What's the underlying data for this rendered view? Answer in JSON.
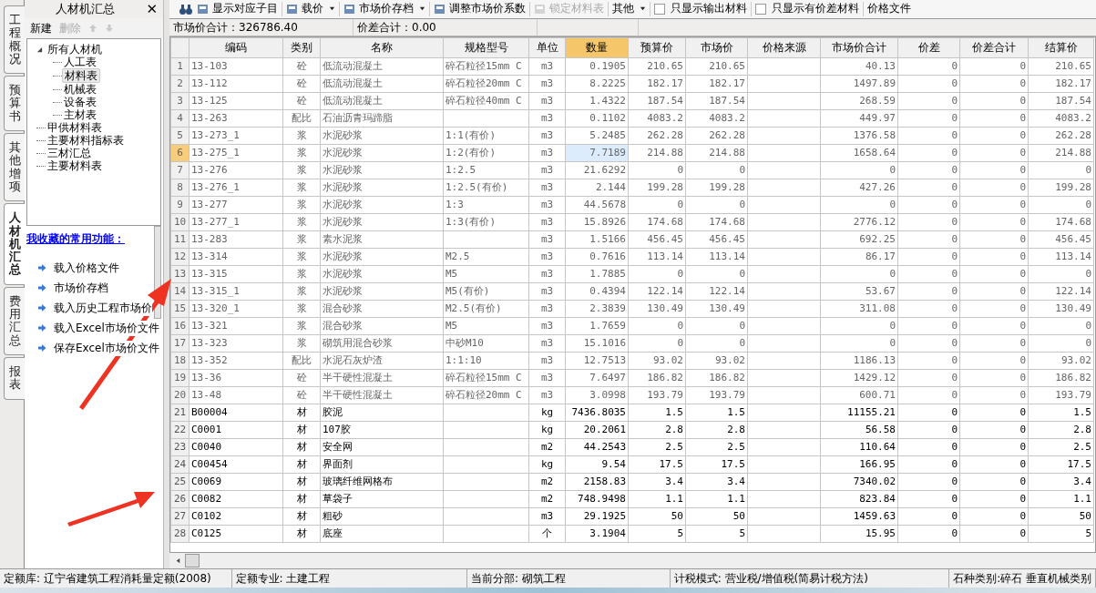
{
  "side_tabs": [
    {
      "label": "工程概况",
      "selected": false
    },
    {
      "label": "预算书",
      "selected": false
    },
    {
      "label": "其他增项",
      "selected": false
    },
    {
      "label": "人材机汇总",
      "selected": true
    },
    {
      "label": "费用汇总",
      "selected": false
    },
    {
      "label": "报表",
      "selected": false
    }
  ],
  "panel": {
    "title": "人材机汇总",
    "close": "✕",
    "actions": [
      {
        "label": "新建",
        "disabled": false
      },
      {
        "label": "删除",
        "disabled": true
      }
    ],
    "tree": [
      {
        "label": "所有人材机",
        "expanded": true,
        "selected": false,
        "children": [
          {
            "label": "人工表",
            "selected": false
          },
          {
            "label": "材料表",
            "selected": true
          },
          {
            "label": "机械表",
            "selected": false
          },
          {
            "label": "设备表",
            "selected": false
          },
          {
            "label": "主材表",
            "selected": false
          }
        ]
      },
      {
        "label": "甲供材料表",
        "selected": false
      },
      {
        "label": "主要材料指标表",
        "selected": false
      },
      {
        "label": "三材汇总",
        "selected": false
      },
      {
        "label": "主要材料表",
        "selected": false
      }
    ],
    "favorites_title": "我收藏的常用功能：",
    "favorites": [
      "载入价格文件",
      "市场价存档",
      "载入历史工程市场价",
      "载入Excel市场价文件",
      "保存Excel市场价文件"
    ]
  },
  "toolbar": [
    {
      "kind": "icon"
    },
    {
      "kind": "button",
      "label": "显示对应子目",
      "disabled": false,
      "dropdown": false
    },
    {
      "kind": "button",
      "label": "载价",
      "disabled": false,
      "dropdown": true
    },
    {
      "kind": "button",
      "label": "市场价存档",
      "disabled": false,
      "dropdown": true
    },
    {
      "kind": "button",
      "label": "调整市场价系数",
      "disabled": false,
      "dropdown": false
    },
    {
      "kind": "button",
      "label": "锁定材料表",
      "disabled": true,
      "dropdown": false
    },
    {
      "kind": "menu",
      "label": "其他",
      "dropdown": true
    },
    {
      "kind": "checkbox",
      "label": "只显示输出材料",
      "checked": false
    },
    {
      "kind": "checkbox",
      "label": "只显示有价差材料",
      "checked": false
    },
    {
      "kind": "text",
      "label": "价格文件"
    }
  ],
  "summary": [
    "市场价合计：326786.40",
    "价差合计：0.00"
  ],
  "table": {
    "columns": [
      {
        "label": "编码",
        "sorted": false
      },
      {
        "label": "类别",
        "sorted": false
      },
      {
        "label": "名称",
        "sorted": false
      },
      {
        "label": "规格型号",
        "sorted": false
      },
      {
        "label": "单位",
        "sorted": false
      },
      {
        "label": "数量",
        "sorted": true
      },
      {
        "label": "预算价",
        "sorted": false
      },
      {
        "label": "市场价",
        "sorted": false
      },
      {
        "label": "价格来源",
        "sorted": false
      },
      {
        "label": "市场价合计",
        "sorted": false
      },
      {
        "label": "价差",
        "sorted": false
      },
      {
        "label": "价差合计",
        "sorted": false
      },
      {
        "label": "结算价",
        "sorted": false
      }
    ],
    "rows": [
      {
        "no": "1",
        "mixture": true,
        "selected": false,
        "code": "13-103",
        "category": "砼",
        "name": "低流动混凝土",
        "spec": "碎石粒径15mm C",
        "unit": "m3",
        "qty": "0.1905",
        "budget": "210.65",
        "market": "210.65",
        "total": "40.13",
        "diff": "0",
        "diff_total": "0",
        "settle": "210.65"
      },
      {
        "no": "2",
        "mixture": true,
        "selected": false,
        "code": "13-112",
        "category": "砼",
        "name": "低流动混凝土",
        "spec": "碎石粒径20mm C",
        "unit": "m3",
        "qty": "8.2225",
        "budget": "182.17",
        "market": "182.17",
        "total": "1497.89",
        "diff": "0",
        "diff_total": "0",
        "settle": "182.17"
      },
      {
        "no": "3",
        "mixture": true,
        "selected": false,
        "code": "13-125",
        "category": "砼",
        "name": "低流动混凝土",
        "spec": "碎石粒径40mm C",
        "unit": "m3",
        "qty": "1.4322",
        "budget": "187.54",
        "market": "187.54",
        "total": "268.59",
        "diff": "0",
        "diff_total": "0",
        "settle": "187.54"
      },
      {
        "no": "4",
        "mixture": true,
        "selected": false,
        "code": "13-263",
        "category": "配比",
        "name": "石油沥青玛蹄脂",
        "unit": "m3",
        "qty": "0.1102",
        "budget": "4083.2",
        "market": "4083.2",
        "total": "449.97",
        "diff": "0",
        "diff_total": "0",
        "settle": "4083.2"
      },
      {
        "no": "5",
        "mixture": true,
        "selected": false,
        "code": "13-273_1",
        "category": "浆",
        "name": "水泥砂浆",
        "spec": "1:1(有价)",
        "unit": "m3",
        "qty": "5.2485",
        "budget": "262.28",
        "market": "262.28",
        "total": "1376.58",
        "diff": "0",
        "diff_total": "0",
        "settle": "262.28"
      },
      {
        "no": "6",
        "mixture": true,
        "selected": true,
        "code": "13-275_1",
        "category": "浆",
        "name": "水泥砂浆",
        "spec": "1:2(有价)",
        "unit": "m3",
        "qty": "7.7189",
        "budget": "214.88",
        "market": "214.88",
        "total": "1658.64",
        "diff": "0",
        "diff_total": "0",
        "settle": "214.88"
      },
      {
        "no": "7",
        "mixture": true,
        "selected": false,
        "code": "13-276",
        "category": "浆",
        "name": "水泥砂浆",
        "spec": "1:2.5",
        "unit": "m3",
        "qty": "21.6292",
        "budget": "0",
        "market": "0",
        "total": "0",
        "diff": "0",
        "diff_total": "0",
        "settle": "0"
      },
      {
        "no": "8",
        "mixture": true,
        "selected": false,
        "code": "13-276_1",
        "category": "浆",
        "name": "水泥砂浆",
        "spec": "1:2.5(有价)",
        "unit": "m3",
        "qty": "2.144",
        "budget": "199.28",
        "market": "199.28",
        "total": "427.26",
        "diff": "0",
        "diff_total": "0",
        "settle": "199.28"
      },
      {
        "no": "9",
        "mixture": true,
        "selected": false,
        "code": "13-277",
        "category": "浆",
        "name": "水泥砂浆",
        "spec": "1:3",
        "unit": "m3",
        "qty": "44.5678",
        "budget": "0",
        "market": "0",
        "total": "0",
        "diff": "0",
        "diff_total": "0",
        "settle": "0"
      },
      {
        "no": "10",
        "mixture": true,
        "selected": false,
        "code": "13-277_1",
        "category": "浆",
        "name": "水泥砂浆",
        "spec": "1:3(有价)",
        "unit": "m3",
        "qty": "15.8926",
        "budget": "174.68",
        "market": "174.68",
        "total": "2776.12",
        "diff": "0",
        "diff_total": "0",
        "settle": "174.68"
      },
      {
        "no": "11",
        "mixture": true,
        "selected": false,
        "code": "13-283",
        "category": "浆",
        "name": "素水泥浆",
        "unit": "m3",
        "qty": "1.5166",
        "budget": "456.45",
        "market": "456.45",
        "total": "692.25",
        "diff": "0",
        "diff_total": "0",
        "settle": "456.45"
      },
      {
        "no": "12",
        "mixture": true,
        "selected": false,
        "code": "13-314",
        "category": "浆",
        "name": "水泥砂浆",
        "spec": "M2.5",
        "unit": "m3",
        "qty": "0.7616",
        "budget": "113.14",
        "market": "113.14",
        "total": "86.17",
        "diff": "0",
        "diff_total": "0",
        "settle": "113.14"
      },
      {
        "no": "13",
        "mixture": true,
        "selected": false,
        "code": "13-315",
        "category": "浆",
        "name": "水泥砂浆",
        "spec": "M5",
        "unit": "m3",
        "qty": "1.7885",
        "budget": "0",
        "market": "0",
        "total": "0",
        "diff": "0",
        "diff_total": "0",
        "settle": "0"
      },
      {
        "no": "14",
        "mixture": true,
        "selected": false,
        "code": "13-315_1",
        "category": "浆",
        "name": "水泥砂浆",
        "spec": "M5(有价)",
        "unit": "m3",
        "qty": "0.4394",
        "budget": "122.14",
        "market": "122.14",
        "total": "53.67",
        "diff": "0",
        "diff_total": "0",
        "settle": "122.14"
      },
      {
        "no": "15",
        "mixture": true,
        "selected": false,
        "code": "13-320_1",
        "category": "浆",
        "name": "混合砂浆",
        "spec": "M2.5(有价)",
        "unit": "m3",
        "qty": "2.3839",
        "budget": "130.49",
        "market": "130.49",
        "total": "311.08",
        "diff": "0",
        "diff_total": "0",
        "settle": "130.49"
      },
      {
        "no": "16",
        "mixture": true,
        "selected": false,
        "code": "13-321",
        "category": "浆",
        "name": "混合砂浆",
        "spec": "M5",
        "unit": "m3",
        "qty": "1.7659",
        "budget": "0",
        "market": "0",
        "total": "0",
        "diff": "0",
        "diff_total": "0",
        "settle": "0"
      },
      {
        "no": "17",
        "mixture": true,
        "selected": false,
        "code": "13-323",
        "category": "浆",
        "name": "砌筑用混合砂浆",
        "spec": "中砂M10",
        "unit": "m3",
        "qty": "15.1016",
        "budget": "0",
        "market": "0",
        "total": "0",
        "diff": "0",
        "diff_total": "0",
        "settle": "0"
      },
      {
        "no": "18",
        "mixture": true,
        "selected": false,
        "code": "13-352",
        "category": "配比",
        "name": "水泥石灰炉渣",
        "spec": "1:1:10",
        "unit": "m3",
        "qty": "12.7513",
        "budget": "93.02",
        "market": "93.02",
        "total": "1186.13",
        "diff": "0",
        "diff_total": "0",
        "settle": "93.02"
      },
      {
        "no": "19",
        "mixture": true,
        "selected": false,
        "code": "13-36",
        "category": "砼",
        "name": "半干硬性混凝土",
        "spec": "碎石粒径15mm C",
        "unit": "m3",
        "qty": "7.6497",
        "budget": "186.82",
        "market": "186.82",
        "total": "1429.12",
        "diff": "0",
        "diff_total": "0",
        "settle": "186.82"
      },
      {
        "no": "20",
        "mixture": true,
        "selected": false,
        "code": "13-48",
        "category": "砼",
        "name": "半干硬性混凝土",
        "spec": "碎石粒径20mm C",
        "unit": "m3",
        "qty": "3.0998",
        "budget": "193.79",
        "market": "193.79",
        "total": "600.71",
        "diff": "0",
        "diff_total": "0",
        "settle": "193.79"
      },
      {
        "no": "21",
        "mixture": false,
        "selected": false,
        "code": "B00004",
        "category": "材",
        "name": "胶泥",
        "unit": "kg",
        "qty": "7436.8035",
        "budget": "1.5",
        "market": "1.5",
        "total": "11155.21",
        "diff": "0",
        "diff_total": "0",
        "settle": "1.5"
      },
      {
        "no": "22",
        "mixture": false,
        "selected": false,
        "code": "C0001",
        "category": "材",
        "name": "107胶",
        "unit": "kg",
        "qty": "20.2061",
        "budget": "2.8",
        "market": "2.8",
        "total": "56.58",
        "diff": "0",
        "diff_total": "0",
        "settle": "2.8"
      },
      {
        "no": "23",
        "mixture": false,
        "selected": false,
        "code": "C0040",
        "category": "材",
        "name": "安全网",
        "unit": "m2",
        "qty": "44.2543",
        "budget": "2.5",
        "market": "2.5",
        "total": "110.64",
        "diff": "0",
        "diff_total": "0",
        "settle": "2.5"
      },
      {
        "no": "24",
        "mixture": false,
        "selected": false,
        "code": "C00454",
        "category": "材",
        "name": "界面剂",
        "unit": "kg",
        "qty": "9.54",
        "budget": "17.5",
        "market": "17.5",
        "total": "166.95",
        "diff": "0",
        "diff_total": "0",
        "settle": "17.5"
      },
      {
        "no": "25",
        "mixture": false,
        "selected": false,
        "code": "C0069",
        "category": "材",
        "name": "玻璃纤维网格布",
        "unit": "m2",
        "qty": "2158.83",
        "budget": "3.4",
        "market": "3.4",
        "total": "7340.02",
        "diff": "0",
        "diff_total": "0",
        "settle": "3.4"
      },
      {
        "no": "26",
        "mixture": false,
        "selected": false,
        "code": "C0082",
        "category": "材",
        "name": "草袋子",
        "unit": "m2",
        "qty": "748.9498",
        "budget": "1.1",
        "market": "1.1",
        "total": "823.84",
        "diff": "0",
        "diff_total": "0",
        "settle": "1.1"
      },
      {
        "no": "27",
        "mixture": false,
        "selected": false,
        "code": "C0102",
        "category": "材",
        "name": "粗砂",
        "unit": "m3",
        "qty": "29.1925",
        "budget": "50",
        "market": "50",
        "total": "1459.63",
        "diff": "0",
        "diff_total": "0",
        "settle": "50"
      },
      {
        "no": "28",
        "mixture": false,
        "selected": false,
        "code": "C0125",
        "category": "材",
        "name": "底座",
        "unit": "个",
        "qty": "3.1904",
        "budget": "5",
        "market": "5",
        "total": "15.95",
        "diff": "0",
        "diff_total": "0",
        "settle": "5"
      }
    ]
  },
  "status_bar": [
    "定额库: 辽宁省建筑工程消耗量定额(2008)",
    "定额专业: 土建工程",
    "当前分部: 砌筑工程",
    "计税模式: 营业税/增值税(简易计税方法)",
    "石种类别:碎石 垂直机械类别"
  ]
}
